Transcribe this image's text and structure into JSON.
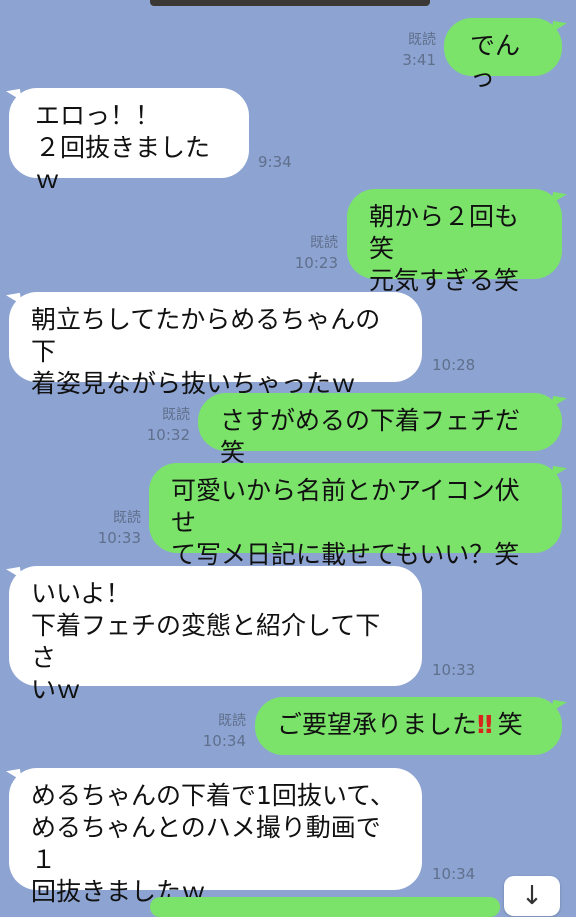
{
  "messages": [
    {
      "dir": "out",
      "text": "でんっ",
      "read": "既読",
      "time": "3:41"
    },
    {
      "dir": "in",
      "text": "エロっ！！\n２回抜きましたｗ",
      "time": "9:34"
    },
    {
      "dir": "out",
      "text": "朝から２回も笑\n元気すぎる笑",
      "read": "既読",
      "time": "10:23"
    },
    {
      "dir": "in",
      "text": "朝立ちしてたからめるちゃんの下\n着姿見ながら抜いちゃったｗ",
      "time": "10:28"
    },
    {
      "dir": "out",
      "text": "さすがめるの下着フェチだ笑",
      "read": "既読",
      "time": "10:32"
    },
    {
      "dir": "out",
      "text": "可愛いから名前とかアイコン伏せ\nて写メ日記に載せてもいい？笑",
      "read": "既読",
      "time": "10:33"
    },
    {
      "dir": "in",
      "text": "いいよ！\n下着フェチの変態と紹介して下さ\nいｗ",
      "time": "10:33"
    },
    {
      "dir": "out",
      "text_before": "ご要望承りました",
      "emoji": "‼",
      "text_after": "笑",
      "read": "既読",
      "time": "10:34"
    },
    {
      "dir": "in",
      "text": "めるちゃんの下着で1回抜いて、\nめるちゃんとのハメ撮り動画で１\n回抜きましたｗ",
      "time": "10:34"
    }
  ],
  "scroll_button": {
    "icon": "down-arrow-icon",
    "label": "↓"
  }
}
